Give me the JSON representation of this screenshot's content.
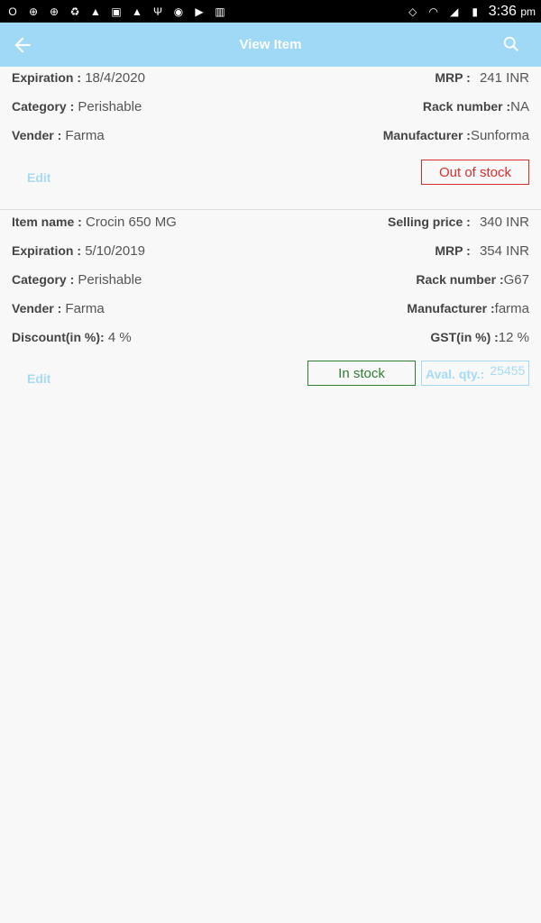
{
  "status_bar": {
    "time": "3:36",
    "ampm": "pm",
    "left_icons": [
      "opera-icon",
      "settings-icon",
      "settings-icon",
      "recycle-icon",
      "app-icon",
      "gallery-icon",
      "app-icon",
      "usb-icon",
      "telegram-icon",
      "play-icon",
      "barcode-icon"
    ],
    "right_icons": [
      "rotate-icon",
      "wifi-icon",
      "signal-icon",
      "battery-icon"
    ]
  },
  "app_bar": {
    "title": "View Item",
    "color": "#9fd9f5"
  },
  "items": [
    {
      "expiration_label": "Expiration :",
      "expiration": "18/4/2020",
      "mrp_label": "MRP :",
      "mrp": "241 INR",
      "category_label": "Category :",
      "category": "Perishable",
      "rack_label": "Rack number :",
      "rack": "NA",
      "vender_label": "Vender :",
      "vender": "Farma",
      "manufacturer_label": "Manufacturer :",
      "manufacturer": "Sunforma",
      "edit_label": "Edit",
      "stock_status": "Out of stock"
    },
    {
      "item_name_label": "Item name :",
      "item_name": "Crocin 650 MG",
      "selling_price_label": "Selling price :",
      "selling_price": "340 INR",
      "expiration_label": "Expiration :",
      "expiration": "5/10/2019",
      "mrp_label": "MRP :",
      "mrp": "354 INR",
      "category_label": "Category :",
      "category": "Perishable",
      "rack_label": "Rack number :",
      "rack": "G67",
      "vender_label": "Vender :",
      "vender": "Farma",
      "manufacturer_label": "Manufacturer :",
      "manufacturer": "farma",
      "discount_label": "Discount(in %):",
      "discount": "4 %",
      "gst_label": "GST(in %) :",
      "gst": "12 %",
      "edit_label": "Edit",
      "stock_status": "In stock",
      "aval_label": "Aval. qty.:",
      "aval_qty": "25455"
    }
  ]
}
